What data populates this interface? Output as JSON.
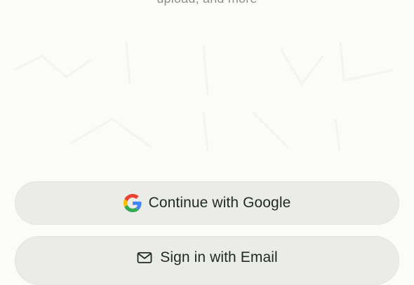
{
  "intro": {
    "subtitle": "upload, and more"
  },
  "auth": {
    "google_label": "Continue with Google",
    "email_label": "Sign in with Email"
  },
  "icons": {
    "google": "google-icon",
    "email": "mail-icon"
  },
  "colors": {
    "background": "#fbfbf8",
    "button_bg": "#ebece7",
    "text": "#1f2a24",
    "subtitle": "#8b918c"
  }
}
